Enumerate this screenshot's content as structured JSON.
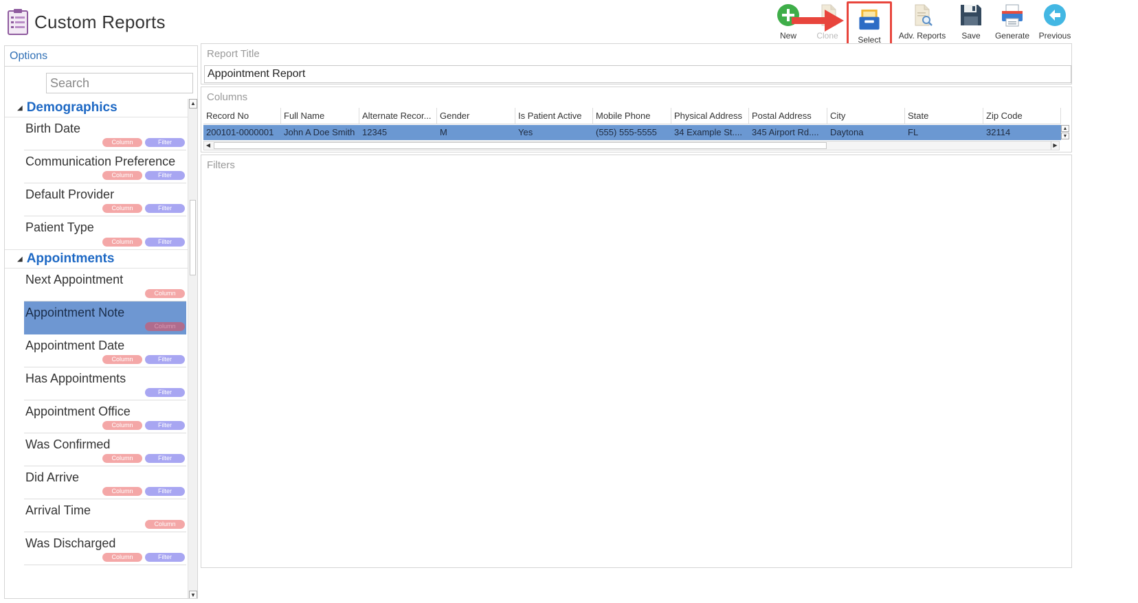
{
  "app": {
    "title": "Custom Reports"
  },
  "toolbar": {
    "buttons": [
      {
        "label": "New",
        "icon": "plus-circle-icon"
      },
      {
        "label": "Clone",
        "icon": "clone-document-icon",
        "disabled": true
      },
      {
        "label": "Select",
        "icon": "drawer-select-icon",
        "highlighted": true
      },
      {
        "label": "Adv. Reports",
        "icon": "document-search-icon"
      },
      {
        "label": "Save",
        "icon": "floppy-disk-icon"
      },
      {
        "label": "Generate",
        "icon": "printer-icon"
      },
      {
        "label": "Previous",
        "icon": "arrow-left-circle-icon"
      }
    ]
  },
  "colors": {
    "accent_blue": "#1d68c4",
    "selection_blue": "#6b98d2",
    "column_tag": "#f4a7a7",
    "filter_tag": "#a8a6f2",
    "highlight_red": "#e8453c"
  },
  "options": {
    "header": "Options",
    "search_placeholder": "Search",
    "tag_labels": {
      "column": "Column",
      "filter": "Filter"
    },
    "groups": [
      {
        "name": "Demographics",
        "items": [
          {
            "name": "Birth Date",
            "column": true,
            "filter": true
          },
          {
            "name": "Communication Preference",
            "column": true,
            "filter": true
          },
          {
            "name": "Default Provider",
            "column": true,
            "filter": true
          },
          {
            "name": "Patient Type",
            "column": true,
            "filter": true
          }
        ]
      },
      {
        "name": "Appointments",
        "items": [
          {
            "name": "Next Appointment",
            "column": true,
            "filter": false
          },
          {
            "name": "Appointment Note",
            "column": true,
            "filter": false,
            "selected": true
          },
          {
            "name": "Appointment Date",
            "column": true,
            "filter": true
          },
          {
            "name": "Has Appointments",
            "column": false,
            "filter": true
          },
          {
            "name": "Appointment Office",
            "column": true,
            "filter": true
          },
          {
            "name": "Was Confirmed",
            "column": true,
            "filter": true
          },
          {
            "name": "Did Arrive",
            "column": true,
            "filter": true
          },
          {
            "name": "Arrival Time",
            "column": true,
            "filter": false
          },
          {
            "name": "Was Discharged",
            "column": true,
            "filter": true
          }
        ]
      }
    ]
  },
  "report_title": {
    "label": "Report Title",
    "value": "Appointment Report"
  },
  "columns": {
    "label": "Columns",
    "headers": [
      "Record No",
      "Full Name",
      "Alternate Recor...",
      "Gender",
      "Is Patient Active",
      "Mobile Phone",
      "Physical Address",
      "Postal Address",
      "City",
      "State",
      "Zip Code"
    ],
    "rows": [
      [
        "200101-0000001",
        "John A Doe Smith",
        "12345",
        "M",
        "Yes",
        "(555) 555-5555",
        "34 Example St....",
        "345 Airport Rd....",
        "Daytona",
        "FL",
        "32114"
      ]
    ]
  },
  "filters": {
    "label": "Filters"
  }
}
